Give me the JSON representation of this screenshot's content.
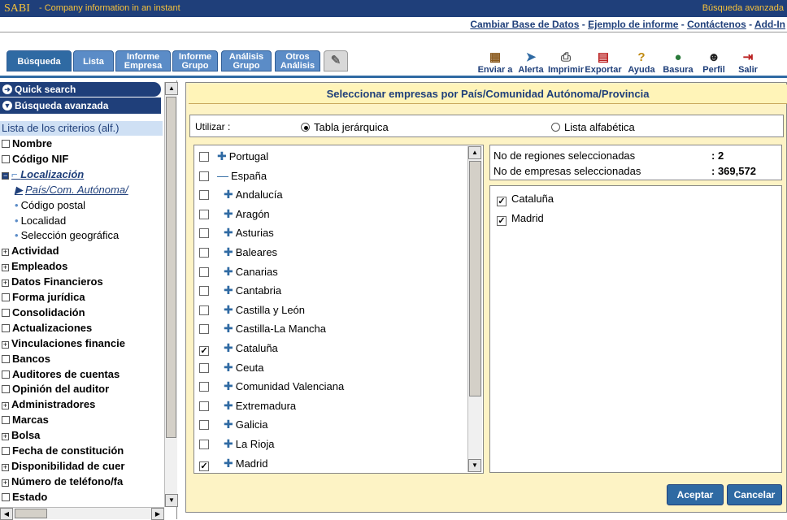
{
  "header": {
    "brand": "SABI",
    "tagline": " - Company information in an instant",
    "advanced_link": "Búsqueda avanzada"
  },
  "links": {
    "change_db": "Cambiar Base de Datos",
    "example": "Ejemplo de informe",
    "contact": "Contáctenos",
    "addins": "Add-In"
  },
  "tabs": [
    {
      "line1": "Búsqueda",
      "line2": ""
    },
    {
      "line1": "Lista",
      "line2": ""
    },
    {
      "line1": "Informe",
      "line2": "Empresa"
    },
    {
      "line1": "Informe",
      "line2": "Grupo"
    },
    {
      "line1": "Análisis",
      "line2": "Grupo"
    },
    {
      "line1": "Otros",
      "line2": "Análisis"
    }
  ],
  "toolbar": {
    "send": "Enviar a",
    "alert": "Alerta",
    "print": "Imprimir",
    "export": "Exportar",
    "help": "Ayuda",
    "trash": "Basura",
    "profile": "Perfil",
    "exit": "Salir"
  },
  "sidebar": {
    "quick_search": "Quick search",
    "advanced_search": "Búsqueda avanzada",
    "criteria_label": "Lista de los criterios (alf.)",
    "criteria": [
      {
        "label": "Nombre",
        "kind": "box"
      },
      {
        "label": "Código NIF",
        "kind": "box"
      },
      {
        "label": "Localización",
        "kind": "minus"
      },
      {
        "label": "País/Com. Autónoma/",
        "kind": "sub-arrow"
      },
      {
        "label": "Código postal",
        "kind": "sub"
      },
      {
        "label": "Localidad",
        "kind": "sub"
      },
      {
        "label": "Selección geográfica",
        "kind": "sub"
      },
      {
        "label": "Actividad",
        "kind": "plus"
      },
      {
        "label": "Empleados",
        "kind": "plus"
      },
      {
        "label": "Datos Financieros",
        "kind": "plus"
      },
      {
        "label": "Forma jurídica",
        "kind": "box"
      },
      {
        "label": "Consolidación",
        "kind": "box"
      },
      {
        "label": "Actualizaciones",
        "kind": "box"
      },
      {
        "label": "Vinculaciones financie",
        "kind": "plus"
      },
      {
        "label": "Bancos",
        "kind": "box"
      },
      {
        "label": "Auditores de cuentas",
        "kind": "box"
      },
      {
        "label": "Opinión del auditor",
        "kind": "box"
      },
      {
        "label": "Administradores",
        "kind": "plus"
      },
      {
        "label": "Marcas",
        "kind": "box"
      },
      {
        "label": "Bolsa",
        "kind": "plus"
      },
      {
        "label": "Fecha de constitución",
        "kind": "box"
      },
      {
        "label": "Disponibilidad de cuer",
        "kind": "plus"
      },
      {
        "label": "Número de teléfono/fa",
        "kind": "plus"
      },
      {
        "label": "Estado",
        "kind": "box"
      }
    ]
  },
  "main": {
    "title": "Seleccionar empresas por País/Comunidad Autónoma/Provincia",
    "use_label": "Utilizar :",
    "option_tree": "Tabla jerárquica",
    "option_alpha": "Lista alfabética",
    "regions": [
      {
        "name": "Portugal",
        "checked": false,
        "icon": "plus",
        "indent": 0
      },
      {
        "name": "España",
        "checked": false,
        "icon": "minus",
        "indent": 0
      },
      {
        "name": "Andalucía",
        "checked": false,
        "icon": "plus",
        "indent": 1
      },
      {
        "name": "Aragón",
        "checked": false,
        "icon": "plus",
        "indent": 1
      },
      {
        "name": "Asturias",
        "checked": false,
        "icon": "plus",
        "indent": 1
      },
      {
        "name": "Baleares",
        "checked": false,
        "icon": "plus",
        "indent": 1
      },
      {
        "name": "Canarias",
        "checked": false,
        "icon": "plus",
        "indent": 1
      },
      {
        "name": "Cantabria",
        "checked": false,
        "icon": "plus",
        "indent": 1
      },
      {
        "name": "Castilla y León",
        "checked": false,
        "icon": "plus",
        "indent": 1
      },
      {
        "name": "Castilla-La Mancha",
        "checked": false,
        "icon": "plus",
        "indent": 1
      },
      {
        "name": "Cataluña",
        "checked": true,
        "icon": "plus",
        "indent": 1
      },
      {
        "name": "Ceuta",
        "checked": false,
        "icon": "plus",
        "indent": 1
      },
      {
        "name": "Comunidad Valenciana",
        "checked": false,
        "icon": "plus",
        "indent": 1
      },
      {
        "name": "Extremadura",
        "checked": false,
        "icon": "plus",
        "indent": 1
      },
      {
        "name": "Galicia",
        "checked": false,
        "icon": "plus",
        "indent": 1
      },
      {
        "name": "La Rioja",
        "checked": false,
        "icon": "plus",
        "indent": 1
      },
      {
        "name": "Madrid",
        "checked": true,
        "icon": "plus",
        "indent": 1
      }
    ],
    "stats": {
      "regions_label": "No de regiones seleccionadas",
      "regions_value": ": 2",
      "companies_label": "No de empresas seleccionadas",
      "companies_value": ": 369,572"
    },
    "selected": [
      "Cataluña",
      "Madrid"
    ],
    "accept": "Aceptar",
    "cancel": "Cancelar"
  },
  "colors": {
    "navy": "#1f3f7a",
    "accent": "#2f6aa3",
    "gold": "#f7c23a",
    "panel": "#fdf3c5"
  }
}
